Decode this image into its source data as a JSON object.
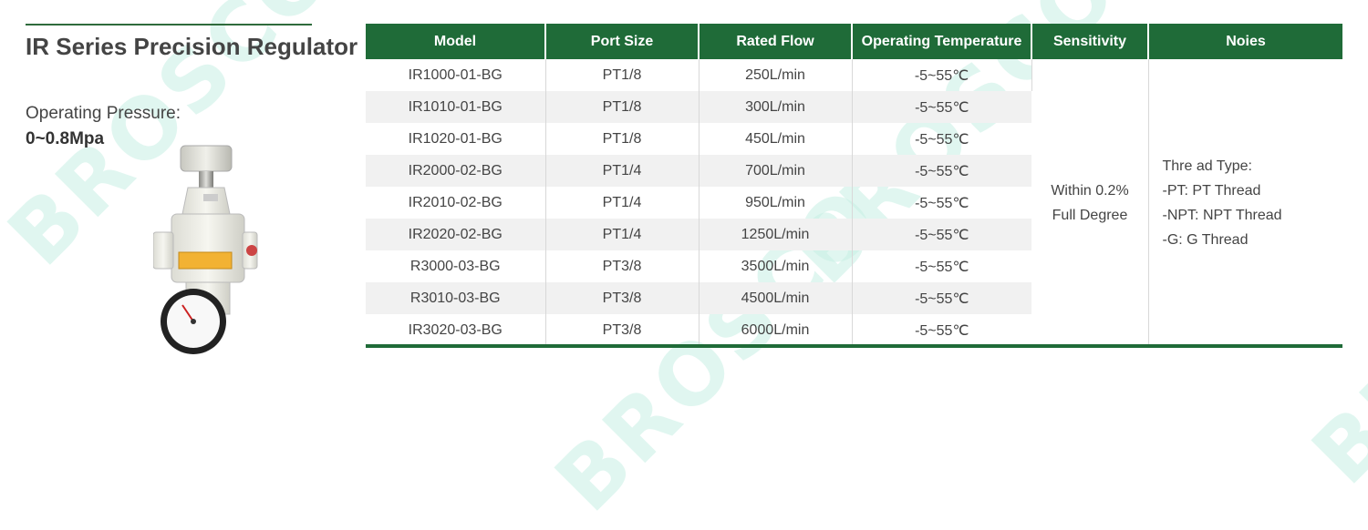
{
  "watermark": "BROSCO",
  "title": "IR Series Precision Regulator",
  "pressure": {
    "label": "Operating Pressure:",
    "value": "0~0.8Mpa"
  },
  "table": {
    "headers": [
      "Model",
      "Port Size",
      "Rated Flow",
      "Operating Temperature",
      "Sensitivity",
      "Noies"
    ],
    "rows": [
      [
        "IR1000-01-BG",
        "PT1/8",
        "250L/min",
        "-5~55℃"
      ],
      [
        "IR1010-01-BG",
        "PT1/8",
        "300L/min",
        "-5~55℃"
      ],
      [
        "IR1020-01-BG",
        "PT1/8",
        "450L/min",
        "-5~55℃"
      ],
      [
        "IR2000-02-BG",
        "PT1/4",
        "700L/min",
        "-5~55℃"
      ],
      [
        "IR2010-02-BG",
        "PT1/4",
        "950L/min",
        "-5~55℃"
      ],
      [
        "IR2020-02-BG",
        "PT1/4",
        "1250L/min",
        "-5~55℃"
      ],
      [
        "R3000-03-BG",
        "PT3/8",
        "3500L/min",
        "-5~55℃"
      ],
      [
        "R3010-03-BG",
        "PT3/8",
        "4500L/min",
        "-5~55℃"
      ],
      [
        "IR3020-03-BG",
        "PT3/8",
        "6000L/min",
        "-5~55℃"
      ]
    ],
    "sensitivity": [
      "Within 0.2%",
      "Full Degree"
    ],
    "noise": [
      "Thre ad Type:",
      "-PT: PT Thread",
      "-NPT: NPT Thread",
      "-G: G Thread"
    ]
  },
  "colors": {
    "header_green": "#1f6b38",
    "rule_green": "#2f6b3c",
    "stripe": "#f1f1f1",
    "watermark": "#c8f0e4"
  }
}
